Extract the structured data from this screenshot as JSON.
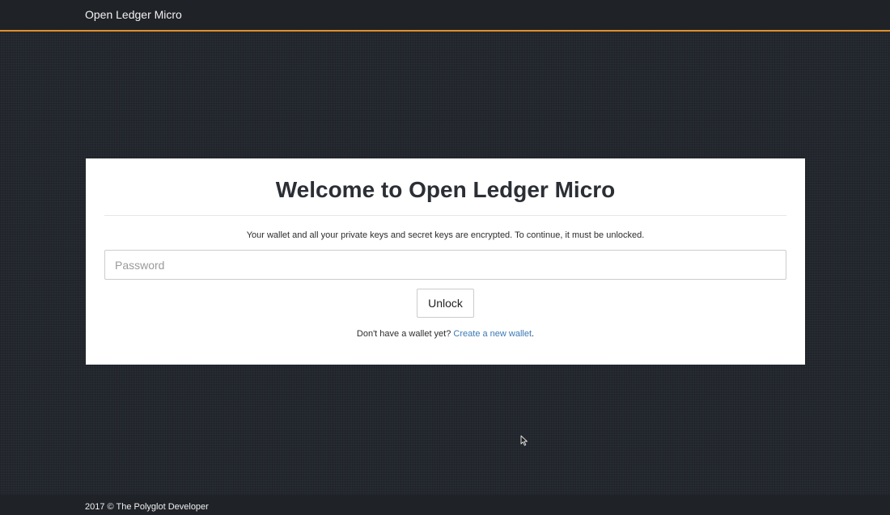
{
  "navbar": {
    "brand": "Open Ledger Micro",
    "accent_color": "#e08e2a"
  },
  "unlock_panel": {
    "title": "Welcome to Open Ledger Micro",
    "intro": "Your wallet and all your private keys and secret keys are encrypted. To continue, it must be unlocked.",
    "password_placeholder": "Password",
    "password_value": "",
    "unlock_label": "Unlock",
    "signup_prefix": "Don't have a wallet yet? ",
    "signup_link": "Create a new wallet",
    "signup_suffix": ".",
    "link_color": "#3a78b5"
  },
  "footer": {
    "text": "2017 © The Polyglot Developer"
  },
  "cursor": {
    "icon": "mouse-pointer-icon"
  }
}
